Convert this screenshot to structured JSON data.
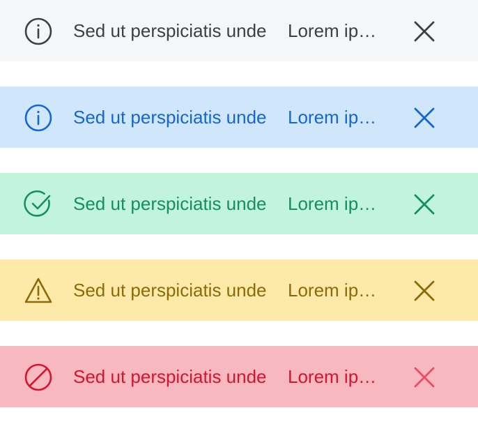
{
  "alerts": [
    {
      "variant": "neutral",
      "icon": "info-icon",
      "title": "Sed ut perspiciatis unde",
      "message": "Lorem ipsum dolor sit amet",
      "background": "#f5f6f8",
      "color": "#3d3f44"
    },
    {
      "variant": "info",
      "icon": "info-icon",
      "title": "Sed ut perspiciatis unde",
      "message": "Lorem ipsum dolor sit amet",
      "background": "#cfe6fb",
      "color": "#1467d2"
    },
    {
      "variant": "success",
      "icon": "check-circle-icon",
      "title": "Sed ut perspiciatis unde",
      "message": "Lorem ipsum dolor sit amet",
      "background": "#c1f3df",
      "color": "#138f63"
    },
    {
      "variant": "warning",
      "icon": "warning-triangle-icon",
      "title": "Sed ut perspiciatis unde",
      "message": "Lorem ipsum dolor sit amet",
      "background": "#fde9a8",
      "color": "#8c6b07"
    },
    {
      "variant": "danger",
      "icon": "prohibited-icon",
      "title": "Sed ut perspiciatis unde",
      "message": "Lorem ipsum dolor sit amet",
      "background": "#f8b8c0",
      "color": "#d7132e"
    }
  ],
  "close_icon": "close-icon"
}
